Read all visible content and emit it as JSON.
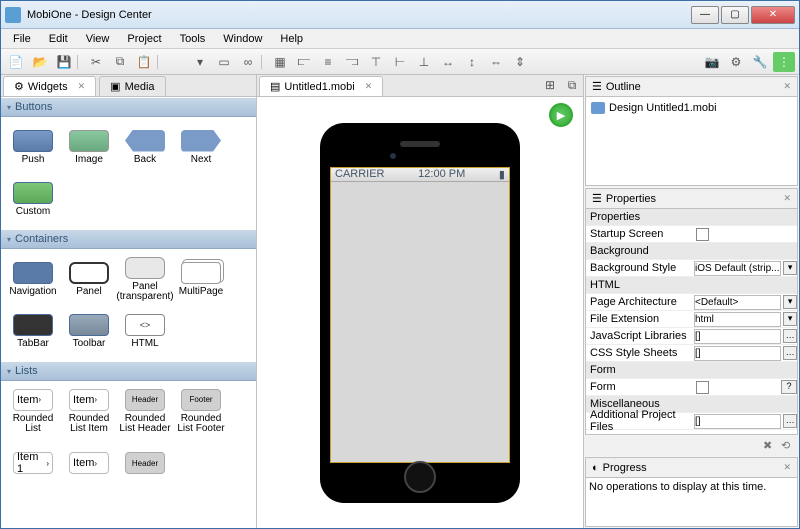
{
  "window": {
    "title": "MobiOne - Design Center"
  },
  "menu": {
    "items": [
      "File",
      "Edit",
      "View",
      "Project",
      "Tools",
      "Window",
      "Help"
    ]
  },
  "leftTabs": {
    "widgets": "Widgets",
    "media": "Media"
  },
  "widgets": {
    "sections": {
      "buttons": {
        "title": "Buttons",
        "items": [
          "Push",
          "Image",
          "Back",
          "Next",
          "Custom"
        ]
      },
      "containers": {
        "title": "Containers",
        "items": [
          "Navigation",
          "Panel",
          "Panel (transparent)",
          "MultiPage",
          "TabBar",
          "Toolbar",
          "HTML"
        ]
      },
      "lists": {
        "title": "Lists",
        "items": [
          "Rounded List",
          "Rounded List Item",
          "Rounded List Header",
          "Rounded List Footer"
        ]
      }
    }
  },
  "centerTab": {
    "label": "Untitled1.mobi"
  },
  "phone": {
    "carrier": "CARRIER",
    "time": "12:00 PM"
  },
  "outline": {
    "title": "Outline",
    "item": "Design Untitled1.mobi"
  },
  "properties": {
    "title": "Properties",
    "groups": {
      "properties": "Properties",
      "background": "Background",
      "html": "HTML",
      "form": "Form",
      "misc": "Miscellaneous"
    },
    "rows": {
      "startup": "Startup Screen",
      "bgstyle": "Background Style",
      "bgstyleVal": "iOS Default (strip...",
      "pagearch": "Page Architecture",
      "pagearchVal": "<Default>",
      "fileext": "File Extension",
      "fileextVal": "html",
      "jslibs": "JavaScript Libraries",
      "jslibsVal": "[]",
      "css": "CSS Style Sheets",
      "cssVal": "[]",
      "formr": "Form",
      "addfiles": "Additional Project Files",
      "addfilesVal": "[]"
    }
  },
  "progress": {
    "title": "Progress",
    "message": "No operations to display at this time."
  },
  "listChips": {
    "item": "Item",
    "item1": "Item 1",
    "header": "Header",
    "footer": "Footer"
  }
}
